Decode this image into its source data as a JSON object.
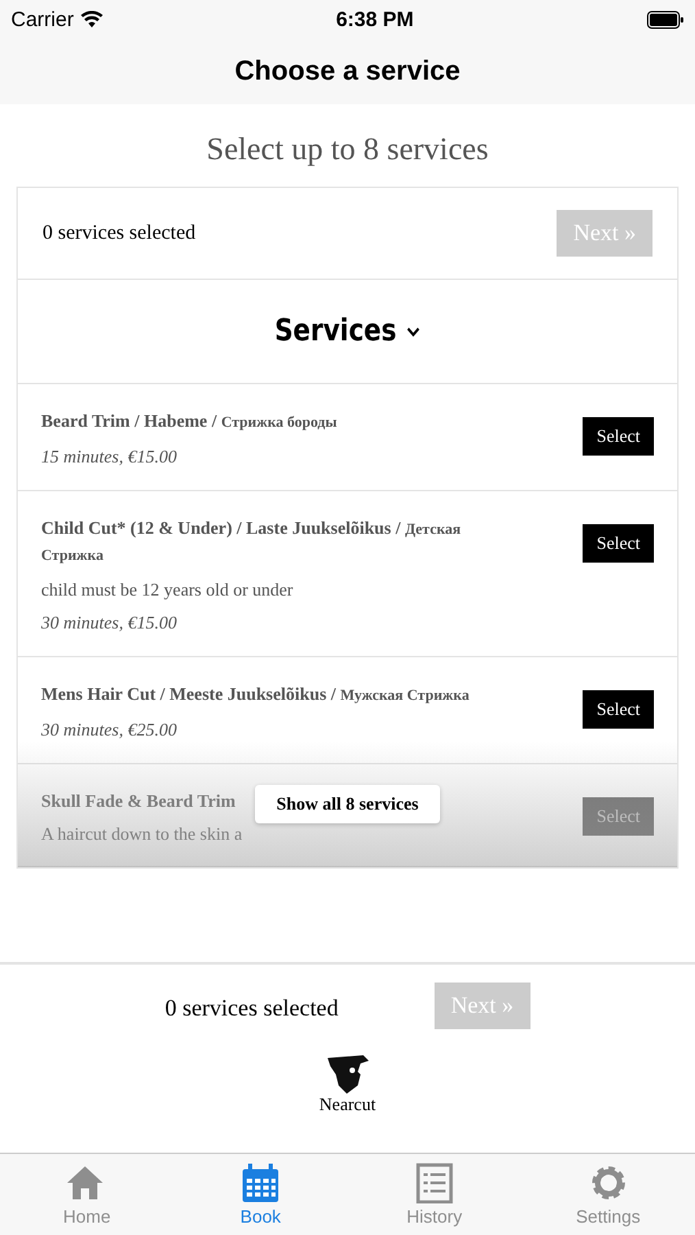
{
  "status_bar": {
    "carrier": "Carrier",
    "time": "6:38 PM"
  },
  "header": {
    "title": "Choose a service"
  },
  "subtitle": "Select up to 8 services",
  "selection_bar": {
    "count": "0 services selected",
    "next": "Next »",
    "disabled": true
  },
  "section": {
    "title": "Services"
  },
  "services": [
    {
      "name": "Beard Trim / Habeme / ",
      "name_ru": "Стрижка бороды",
      "duration": "15 minutes, €15.00",
      "button": "Select",
      "faded": false
    },
    {
      "name": "Child Cut* (12 & Under) / Laste Juukselõikus / ",
      "name_ru": "Детская Стрижка",
      "description": "child must be 12 years old or under",
      "duration": "30 minutes, €15.00",
      "button": "Select",
      "faded": false
    },
    {
      "name": "Mens Hair Cut / Meeste Juukselõikus / ",
      "name_ru": "Мужская Стрижка",
      "duration": "30 minutes, €25.00",
      "button": "Select",
      "faded": false
    },
    {
      "name": "Skull Fade & Beard Trim",
      "description": "A haircut down to the skin a",
      "button": "Select",
      "faded": true
    }
  ],
  "show_all": "Show all 8 services",
  "footer_bar": {
    "count": "0 services selected",
    "next": "Next »",
    "disabled": true
  },
  "brand": {
    "name": "Nearcut"
  },
  "tab_bar": [
    {
      "label": "Home",
      "selected": false
    },
    {
      "label": "Book",
      "selected": true
    },
    {
      "label": "History",
      "selected": false
    },
    {
      "label": "Settings",
      "selected": false
    }
  ]
}
